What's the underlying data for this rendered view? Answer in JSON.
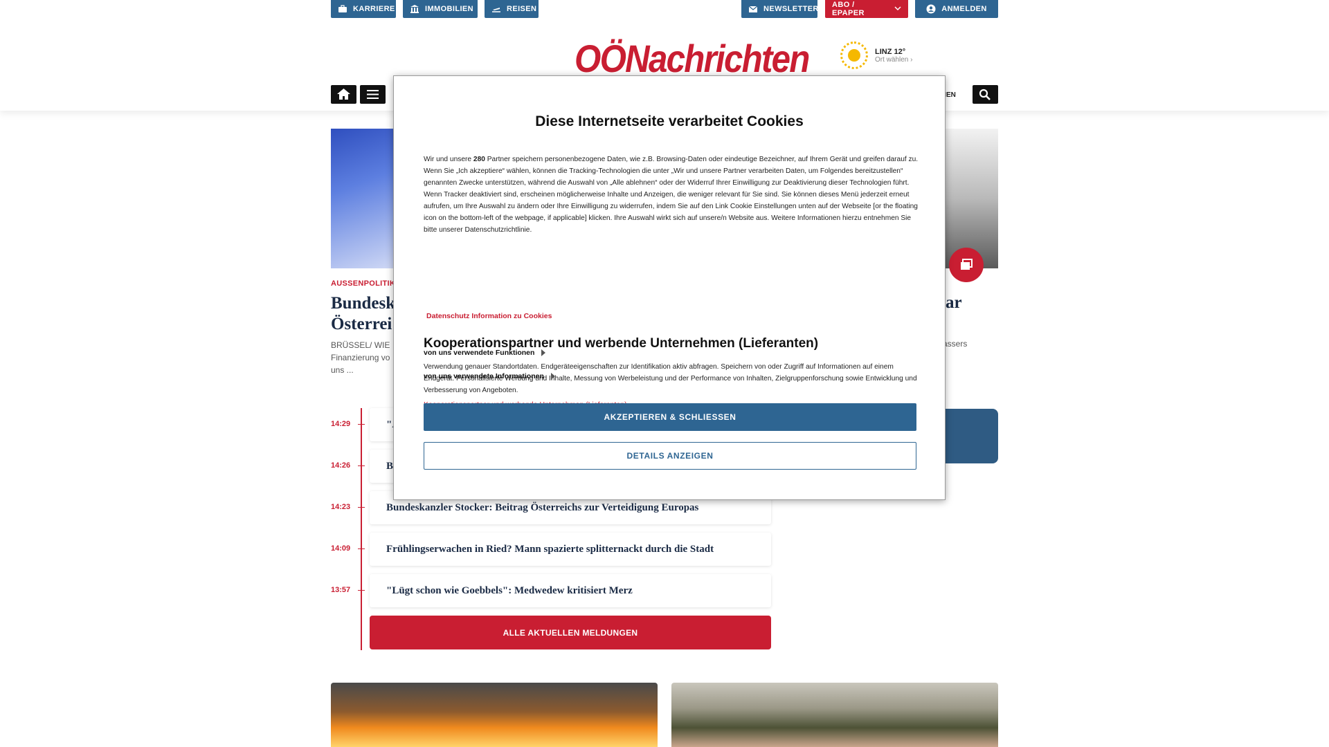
{
  "topbar": {
    "karriere": "KARRIERE",
    "immobilien": "IMMOBILIEN",
    "reisen": "REISEN",
    "newsletter": "NEWSLETTER",
    "abo": "ABO / EPAPER",
    "anmelden": "ANMELDEN"
  },
  "header": {
    "logo": "OÖNachrichten",
    "weather_city": "LINZ 12°",
    "weather_choose": "Ort wählen",
    "nav_fragment": "ONEN"
  },
  "background": {
    "section_label": "AUSSENPOLITIK",
    "headline_line1": "Bundesk",
    "headline_line2": "Österrei",
    "teaser_line1": "BRÜSSEL/ WIE",
    "teaser_line2": "Finanzierung vo",
    "teaser_line3": "uns ...",
    "headline_right": "ar",
    "teaser_right": "assers",
    "timeline": [
      {
        "time": "14:29",
        "title": "\"A"
      },
      {
        "time": "14:26",
        "title": "B"
      },
      {
        "time": "14:23",
        "title": "Bundeskanzler Stocker: Beitrag Österreichs zur Verteidigung Europas"
      },
      {
        "time": "14:09",
        "title": "Frühlingserwachen in Ried? Mann spazierte splitternackt durch die Stadt"
      },
      {
        "time": "13:57",
        "title": "\"Lügt schon wie Goebbels\": Medwedew kritisiert Merz"
      }
    ],
    "all_news_button": "ALLE AKTUELLEN MELDUNGEN"
  },
  "cookie_modal": {
    "title": "Diese Internetseite verarbeitet Cookies",
    "body_pre": "Wir und unsere ",
    "body_partner_count": "280",
    "body_post": " Partner speichern personenbezogene Daten, wie z.B. Browsing-Daten oder eindeutige Bezeichner, auf Ihrem Gerät und greifen darauf zu. Wenn Sie „Ich akzeptiere“ wählen, können die Tracking-Technologien die unter „Wir und unsere Partner verarbeiten Daten, um Folgendes bereitzustellen“ genannten Zwecke unterstützen, während die Auswahl von „Alle ablehnen“ oder der Widerruf Ihrer Einwilligung zur Deaktivierung dieser Technologien führt. Wenn Tracker deaktiviert sind, erscheinen möglicherweise Inhalte und Anzeigen, die weniger relevant für Sie sind. Sie können dieses Menü jederzeit erneut aufrufen, um Ihre Auswahl zu ändern oder Ihre Einwilligung zu widerrufen, indem Sie auf den Link Cookie Einstellungen unten auf der Webseite [or the floating icon on the bottom-left of the webpage, if applicable] klicken. Ihre Auswahl wirkt sich auf unsere/n Website aus. Weitere Informationen hierzu entnehmen Sie bitte unserer Datenschutzrichtlinie.",
    "privacy_link": "Datenschutz Information zu Cookies",
    "partners_title": "Kooperationspartner und werbende Unternehmen (Lieferanten)",
    "partners_text": "Verwendung genauer Standortdaten. Endgeräteeigenschaften zur Identifikation aktiv abfragen. Speichern von oder Zugriff auf Informationen auf einem Endgerät. Personalisierte Werbung und Inhalte, Messung von Werbeleistung und der Performance von Inhalten, Zielgruppenforschung sowie Entwicklung und Verbesserung von Angeboten.",
    "partners_link": "Kooperationspartner und werbende Unternehmen (Lieferanten)",
    "functions_toggle": "von uns verwendete Funktionen",
    "information_toggle": "von uns verwendete Informationen",
    "accept_button": "AKZEPTIEREN & SCHLIESSEN",
    "details_button": "DETAILS ANZEIGEN"
  },
  "colors": {
    "brand_red": "#c91e32",
    "brand_blue": "#2e6592"
  }
}
